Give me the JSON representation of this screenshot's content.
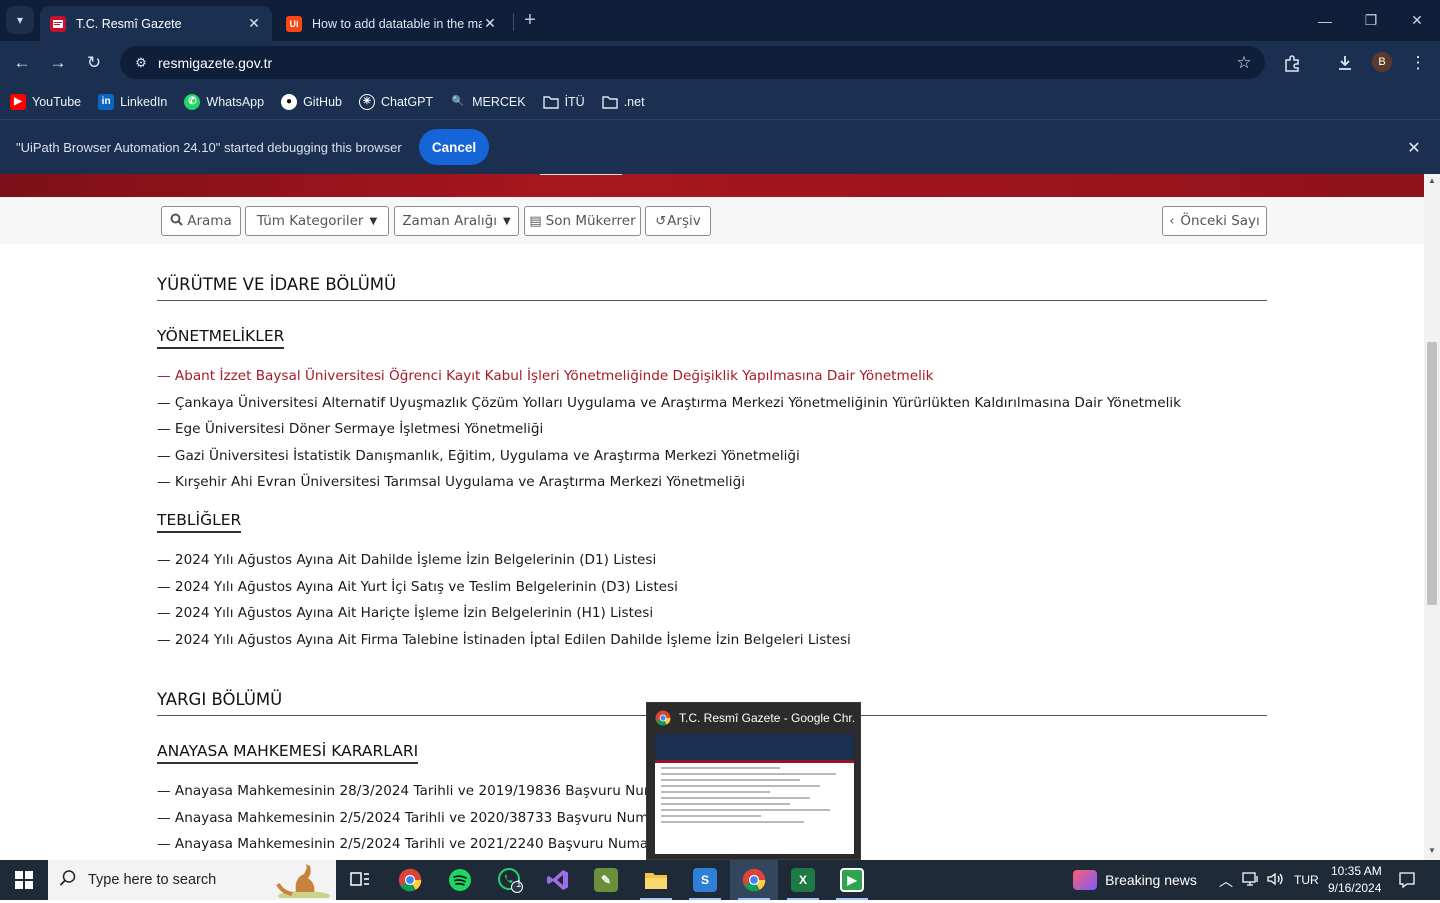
{
  "browser": {
    "tabs": [
      {
        "title": "T.C. Resmî Gazete",
        "active": true
      },
      {
        "title": "How to add datatable in the ma",
        "active": false
      }
    ],
    "url": "resmigazete.gov.tr",
    "profile_initial": "B",
    "bookmarks": [
      {
        "label": "YouTube",
        "icon": "youtube-icon",
        "color": "#ff0000"
      },
      {
        "label": "LinkedIn",
        "icon": "linkedin-icon",
        "color": "#0a66c2"
      },
      {
        "label": "WhatsApp",
        "icon": "whatsapp-icon",
        "color": "#25d366"
      },
      {
        "label": "GitHub",
        "icon": "github-icon",
        "color": "#ffffff"
      },
      {
        "label": "ChatGPT",
        "icon": "chatgpt-icon",
        "color": "#ffffff"
      },
      {
        "label": "MERCEK",
        "icon": "mercek-icon",
        "color": "#6a7cff"
      },
      {
        "label": "İTÜ",
        "icon": "folder-icon",
        "color": "#dfe7f3"
      },
      {
        "label": ".net",
        "icon": "folder-icon",
        "color": "#dfe7f3"
      }
    ],
    "infobar": {
      "message": "\"UiPath Browser Automation 24.10\" started debugging this browser",
      "cancel_label": "Cancel"
    }
  },
  "toolbar": {
    "search_label": "Arama",
    "category_label": "Tüm Kategoriler",
    "date_range_label": "Zaman Aralığı",
    "repeated_label": "Son Mükerrer",
    "archive_label": "Arşiv",
    "previous_label": "Önceki Sayı"
  },
  "content": {
    "section1_title": "YÜRÜTME VE İDARE BÖLÜMÜ",
    "regulations_title": "YÖNETMELİKLER",
    "regulations": [
      "— Abant İzzet Baysal Üniversitesi Öğrenci Kayıt Kabul İşleri Yönetmeliğinde Değişiklik Yapılmasına Dair Yönetmelik",
      "— Çankaya Üniversitesi Alternatif Uyuşmazlık Çözüm Yolları Uygulama ve Araştırma Merkezi Yönetmeliğinin Yürürlükten Kaldırılmasına Dair Yönetmelik",
      "— Ege Üniversitesi Döner Sermaye İşletmesi Yönetmeliği",
      "— Gazi Üniversitesi İstatistik Danışmanlık, Eğitim, Uygulama ve Araştırma Merkezi Yönetmeliği",
      "— Kırşehir Ahi Evran Üniversitesi Tarımsal Uygulama ve Araştırma Merkezi Yönetmeliği"
    ],
    "communiques_title": "TEBLİĞLER",
    "communiques": [
      "— 2024 Yılı Ağustos Ayına Ait Dahilde İşleme İzin Belgelerinin (D1) Listesi",
      "— 2024 Yılı Ağustos Ayına Ait Yurt İçi Satış ve Teslim Belgelerinin (D3) Listesi",
      "— 2024 Yılı Ağustos Ayına Ait Hariçte İşleme İzin Belgelerinin (H1) Listesi",
      "— 2024 Yılı Ağustos Ayına Ait Firma Talebine İstinaden İptal Edilen Dahilde İşleme İzin Belgeleri Listesi"
    ],
    "section2_title": "YARGI BÖLÜMÜ",
    "court_title": "ANAYASA MAHKEMESİ KARARLARI",
    "court_items": [
      "— Anayasa Mahkemesinin 28/3/2024 Tarihli ve 2019/19836 Başvuru Numar",
      "— Anayasa Mahkemesinin 2/5/2024 Tarihli ve 2020/38733 Başvuru Numar",
      "— Anayasa Mahkemesinin 2/5/2024 Tarihli ve 2021/2240 Başvuru Numara"
    ]
  },
  "hover_preview": {
    "title": "T.C. Resmî Gazete - Google Chr..."
  },
  "taskbar": {
    "search_placeholder": "Type here to search",
    "whatsapp_badge": "1",
    "news_label": "Breaking news",
    "language": "TUR",
    "time": "10:35 AM",
    "date": "9/16/2024"
  }
}
